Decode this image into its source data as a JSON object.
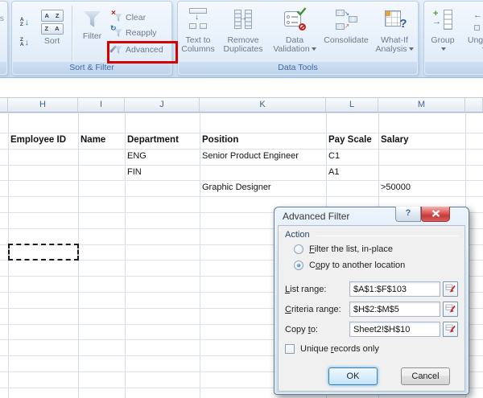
{
  "ribbon": {
    "edge_fragment": "s",
    "sort_filter": {
      "group_label": "Sort & Filter",
      "sort": "Sort",
      "filter": "Filter",
      "clear": "Clear",
      "reapply": "Reapply",
      "advanced": "Advanced",
      "sort_glyphs": {
        "a": "A",
        "z": "Z",
        "arrow_down": "↓"
      }
    },
    "data_tools": {
      "group_label": "Data Tools",
      "text_to_columns_line1": "Text to",
      "text_to_columns_line2": "Columns",
      "remove_duplicates_line1": "Remove",
      "remove_duplicates_line2": "Duplicates",
      "data_validation_line1": "Data",
      "data_validation_line2": "Validation",
      "consolidate": "Consolidate",
      "what_if_line1": "What-If",
      "what_if_line2": "Analysis"
    },
    "outline": {
      "group": "Group",
      "ungroup": "Ungroup"
    }
  },
  "annotation": {
    "red_box_color": "#d60000"
  },
  "sheet": {
    "column_headers": [
      "H",
      "I",
      "J",
      "K",
      "L",
      "M"
    ],
    "cells": [
      {
        "col": "H",
        "row": 2,
        "text": "Employee ID",
        "bold": true
      },
      {
        "col": "I",
        "row": 2,
        "text": "Name",
        "bold": true
      },
      {
        "col": "J",
        "row": 2,
        "text": "Department",
        "bold": true
      },
      {
        "col": "K",
        "row": 2,
        "text": "Position",
        "bold": true
      },
      {
        "col": "L",
        "row": 2,
        "text": "Pay Scale",
        "bold": true
      },
      {
        "col": "M",
        "row": 2,
        "text": "Salary",
        "bold": true
      },
      {
        "col": "J",
        "row": 3,
        "text": "ENG",
        "bold": false
      },
      {
        "col": "K",
        "row": 3,
        "text": "Senior Product Engineer",
        "bold": false
      },
      {
        "col": "L",
        "row": 3,
        "text": "C1",
        "bold": false
      },
      {
        "col": "J",
        "row": 4,
        "text": "FIN",
        "bold": false
      },
      {
        "col": "L",
        "row": 4,
        "text": "A1",
        "bold": false
      },
      {
        "col": "K",
        "row": 5,
        "text": "Graphic Designer",
        "bold": false
      },
      {
        "col": "M",
        "row": 5,
        "text": ">50000",
        "bold": false
      }
    ]
  },
  "dialog": {
    "title": "Advanced Filter",
    "help_glyph": "?",
    "close_glyph": "x",
    "action_label": "Action",
    "radios": [
      {
        "pre": "",
        "accel": "F",
        "post": "ilter the list, in-place",
        "selected": false
      },
      {
        "pre": "C",
        "accel": "o",
        "post": "py to another location",
        "selected": true
      }
    ],
    "fields": [
      {
        "pre": "",
        "accel": "L",
        "post": "ist range:",
        "value": "$A$1:$F$103"
      },
      {
        "pre": "",
        "accel": "C",
        "post": "riteria range:",
        "value": "$H$2:$M$5"
      },
      {
        "pre": "Copy ",
        "accel": "t",
        "post": "o:",
        "value": "Sheet2!$H$10"
      }
    ],
    "checkbox": {
      "pre": "Unique ",
      "accel": "r",
      "post": "ecords only",
      "checked": false
    },
    "ok": "OK",
    "cancel": "Cancel"
  }
}
